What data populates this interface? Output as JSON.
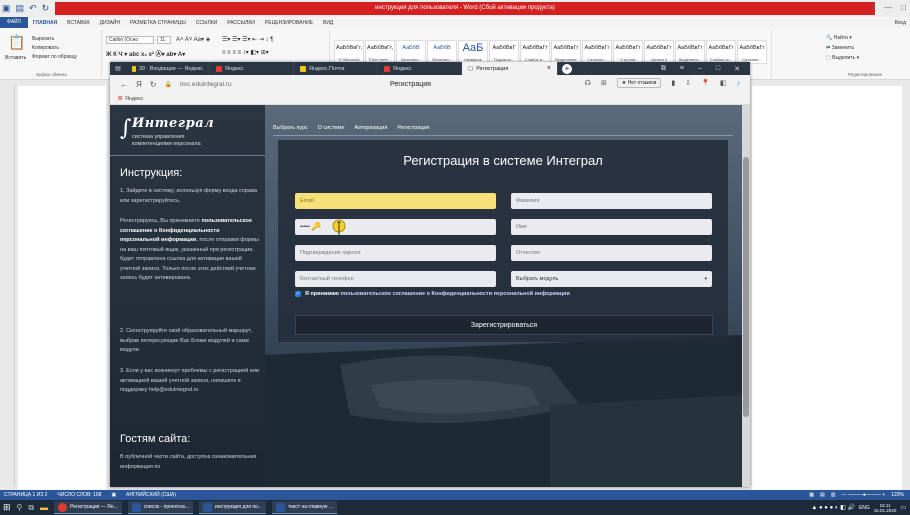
{
  "word": {
    "title": "инструкция для пользователя - Word (Сбой активации продукта)",
    "tabs": [
      "ФАЙЛ",
      "ГЛАВНАЯ",
      "ВСТАВКА",
      "ДИЗАЙН",
      "РАЗМЕТКА СТРАНИЦЫ",
      "ССЫЛКИ",
      "РАССЫЛКИ",
      "РЕЦЕНЗИРОВАНИЕ",
      "ВИД"
    ],
    "user": "Вход",
    "clipboard": {
      "paste": "Вставить",
      "cut": "Вырезать",
      "copy": "Копировать",
      "format": "Формат по образцу",
      "label": "Буфер обмена"
    },
    "font": {
      "name": "Calibri (Осно",
      "size": "11"
    },
    "styles": [
      {
        "preview": "АаБбВвГг,",
        "name": "¶ Обычный"
      },
      {
        "preview": "АаБбВвГг,",
        "name": "¶ Без инте..."
      },
      {
        "preview": "АаБбВ",
        "name": "Заголово..."
      },
      {
        "preview": "АаБбВ",
        "name": "Заголово..."
      },
      {
        "preview": "АаБ",
        "name": "Название"
      },
      {
        "preview": "АаБбВвГ",
        "name": "Подзагол..."
      },
      {
        "preview": "АаБбВвГг",
        "name": "Слабое в..."
      },
      {
        "preview": "АаБбВвГг",
        "name": "Выделение"
      },
      {
        "preview": "АаБбВвГг",
        "name": "Сильное..."
      },
      {
        "preview": "АаБбВвГг",
        "name": "Строгий"
      },
      {
        "preview": "АаБбВвГг",
        "name": "Цитата 2"
      },
      {
        "preview": "АаБбВвГг",
        "name": "Выделенн..."
      },
      {
        "preview": "АаБбВвГг",
        "name": "Слабая сс..."
      },
      {
        "preview": "АаБбВвГг",
        "name": "Сильная..."
      }
    ],
    "editing": {
      "find": "Найти",
      "replace": "Заменить",
      "select": "Выделить",
      "label": "Редактирование"
    },
    "status": {
      "page": "СТРАНИЦА 1 ИЗ 2",
      "words": "ЧИСЛО СЛОВ: 168",
      "lang": "АНГЛИЙСКИЙ (США)",
      "zoom": "120%"
    }
  },
  "taskbar": {
    "items": [
      "Регистрация — Ян...",
      "список - проектна...",
      "инструкция для по...",
      "текст на главную ..."
    ],
    "lang": "ENG",
    "time": "15:11",
    "date": "15.01.2020"
  },
  "browser": {
    "tabs": [
      {
        "label": "39 · Входящие — Яндекс",
        "color": "#f5c518"
      },
      {
        "label": "Яндекс",
        "color": "#e53935"
      },
      {
        "label": "Яндекс.Почта",
        "color": "#f5c518"
      },
      {
        "label": "Яндекс",
        "color": "#e53935"
      },
      {
        "label": "Регистрация",
        "color": "#888888"
      }
    ],
    "url": "imc.eduintegral.ru",
    "page_title": "Регистрация",
    "review_btn": "Нет отзывов",
    "bookmark": "Яндекс"
  },
  "site": {
    "logo": {
      "name": "Интеграл",
      "sub1": "система управления",
      "sub2": "компетенциями персонала"
    },
    "nav": [
      "Выбрать курс",
      "О системе",
      "Авторизация",
      "Регистрация"
    ],
    "instr_title": "Инструкция:",
    "instr_p1": "1. Зайдите в систему, используя форму входа справа или зарегистрируйтесь.",
    "instr_p2a": "Регистрируясь, Вы принимаете ",
    "instr_p2b": "пользовательское соглашение о Конфиденциальности персональной информации",
    "instr_p2c": ", после отправки формы на ваш почтовый ящик, указанный при регистрации, будет отправлена ссылка для активации вашей учетной записи. Только после этих действий учетная запись будет активирована.",
    "instr_p3": "2. Сконструируйте свой образовательный маршрут, выбрав интересующие Вас Блоки модулей и сами модули",
    "instr_p4": "3. Если у вас возникнут проблемы с регистрацией или активацией вашей учетной записи, напишите в поддержку help@eduintegral.ru",
    "guests_title": "Гостям сайта:",
    "guests_p": "В публичной части сайта, доступна ознакомительная информация по",
    "form": {
      "title": "Регистрация в системе Интеграл",
      "email": "Email",
      "surname": "Фамилия",
      "password": "•••••",
      "name": "Имя",
      "password_confirm": "Подтверждение пароля",
      "patronymic": "Отчество",
      "phone": "Контактный телефон",
      "module": "Выбрать модуль",
      "agree_pre": "Я принимаю",
      "agree_link": "пользовательское соглашение о Конфиденциальности персональной информации",
      "submit": "Зарегистрироваться"
    }
  }
}
